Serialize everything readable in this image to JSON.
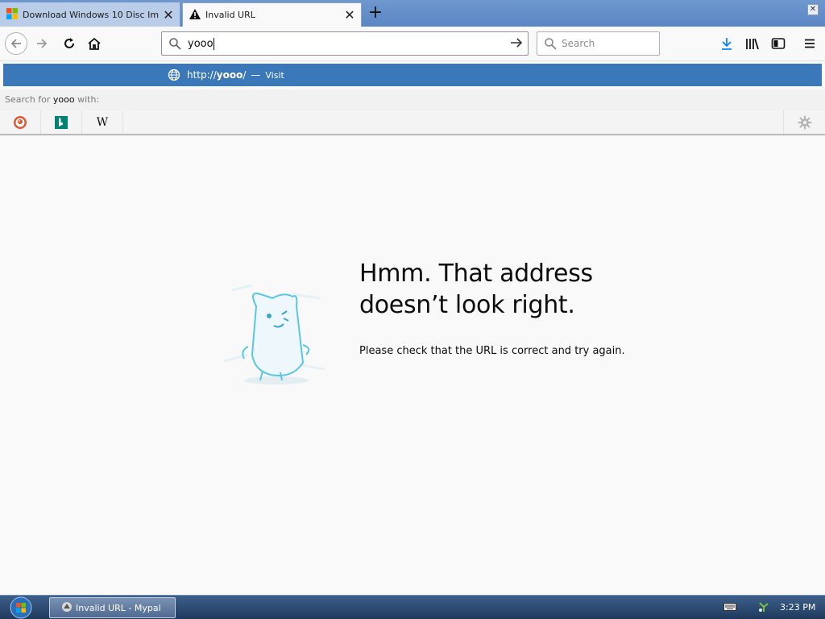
{
  "tabs": [
    {
      "title": "Download Windows 10 Disc Im",
      "icon": "windows-logo-icon",
      "active": false
    },
    {
      "title": "Invalid URL",
      "icon": "warning-icon",
      "active": true
    }
  ],
  "urlbar": {
    "value": "yooo"
  },
  "searchbar": {
    "placeholder": "Search"
  },
  "dropdown": {
    "visit_url_prefix": "http://",
    "visit_url_host": "yooo",
    "visit_url_suffix": "/",
    "visit_separator": "—",
    "visit_action": "Visit",
    "search_prefix": "Search for ",
    "search_term": "yooo",
    "search_suffix": " with:",
    "engines": [
      "duckduckgo-icon",
      "bing-icon",
      "wikipedia-icon"
    ]
  },
  "error_page": {
    "title_line1": "Hmm. That address",
    "title_line2": "doesn’t look right.",
    "description": "Please check that the URL is correct and try again."
  },
  "taskbar": {
    "task_label": "Invalid URL - Mypal",
    "clock": "3:23 PM"
  },
  "colors": {
    "highlight": "#3b78b9",
    "taskbar": "#2a4a72",
    "tabstrip": "#6f98cf"
  }
}
